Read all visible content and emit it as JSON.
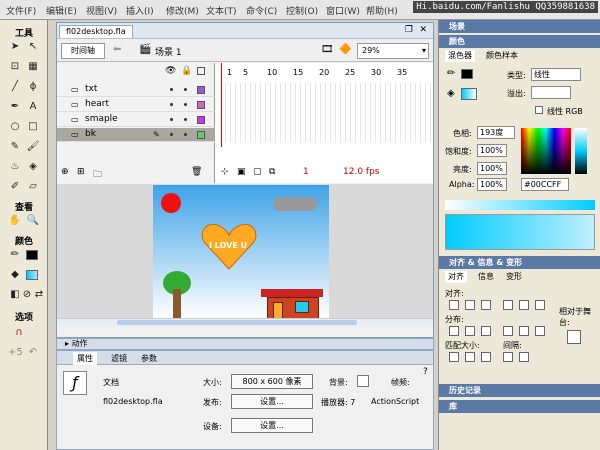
{
  "menu": {
    "items": [
      "文件(F)",
      "编辑(E)",
      "视图(V)",
      "插入(I)",
      "修改(M)",
      "文本(T)",
      "命令(C)",
      "控制(O)",
      "窗口(W)",
      "帮助(H)"
    ],
    "watermark": "Hi.baidu.com/Fanlishu QQ359881638"
  },
  "toolbox": {
    "title_tools": "工具",
    "title_view": "查看",
    "title_color": "颜色",
    "title_options": "选项"
  },
  "document": {
    "tab": "fl02desktop.fla",
    "timeline_btn": "时间轴",
    "scene": "场景 1",
    "zoom": "29%",
    "fps": "12.0 fps",
    "current_frame": "1",
    "frame_numbers": [
      "1",
      "5",
      "10",
      "15",
      "20",
      "25",
      "30",
      "35"
    ],
    "layers": [
      {
        "name": "txt",
        "color": "#9b59d0"
      },
      {
        "name": "heart",
        "color": "#cc66cc"
      },
      {
        "name": "smaple",
        "color": "#cc33ff"
      },
      {
        "name": "bk",
        "color": "#66cc66"
      }
    ]
  },
  "stage": {
    "heart_text": "I LOVE U",
    "colors": {
      "sun": "#ee1111",
      "heart": "#ffaa22",
      "house": "#cc4422",
      "sky": "#3fa3e8"
    }
  },
  "actions": {
    "title": "动作"
  },
  "properties": {
    "tabs": [
      "属性",
      "滤镜",
      "参数"
    ],
    "doc_label": "文档",
    "file": "fl02desktop.fla",
    "size_label": "大小:",
    "size_value": "800 x 600 像素",
    "bg_label": "背景:",
    "fps_label": "帧频:",
    "publish_label": "发布:",
    "settings_btn": "设置...",
    "player_label": "播放器: 7",
    "script_label": "ActionScript",
    "device_label": "设备:",
    "device_btn": "设置..."
  },
  "right_panel": {
    "scene_header": "场景",
    "color_header": "颜色",
    "color_tabs": [
      "混色器",
      "颜色样本"
    ],
    "type_label": "类型:",
    "type_value": "线性",
    "overflow_label": "溢出:",
    "linear_rgb": "线性 RGB",
    "hue_label": "色相:",
    "hue_value": "193度",
    "sat_label": "饱和度:",
    "sat_value": "100%",
    "bright_label": "亮度:",
    "bright_value": "100%",
    "alpha_label": "Alpha:",
    "alpha_value": "100%",
    "hex_value": "#00CCFF",
    "align_header": "对齐 & 信息 & 变形",
    "align_tabs": [
      "对齐",
      "信息",
      "变形"
    ],
    "align_label": "对齐:",
    "dist_label": "分布:",
    "match_label": "匹配大小:",
    "space_label": "间隔:",
    "to_stage": "相对于舞台:",
    "history_header": "历史记录",
    "library_header": "库"
  }
}
